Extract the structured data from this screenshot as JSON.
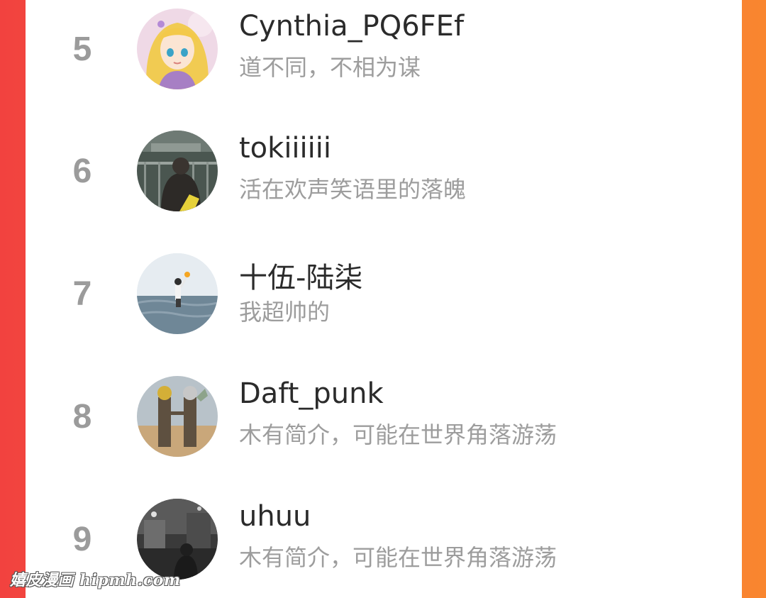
{
  "leaderboard": {
    "entries": [
      {
        "rank": "5",
        "username": "Cynthia_PQ6FEf",
        "bio": "道不同，不相为谋",
        "avatar_icon": "anime-girl-avatar"
      },
      {
        "rank": "6",
        "username": "tokiiiiii",
        "bio": "活在欢声笑语里的落魄",
        "avatar_icon": "bridge-railing-avatar"
      },
      {
        "rank": "7",
        "username": "十伍-陆柒",
        "bio": "我超帅的",
        "avatar_icon": "sea-torch-avatar"
      },
      {
        "rank": "8",
        "username": "Daft_punk",
        "bio": "木有简介，可能在世界角落游荡",
        "avatar_icon": "two-figures-avatar"
      },
      {
        "rank": "9",
        "username": "uhuu",
        "bio": "木有简介，可能在世界角落游荡",
        "avatar_icon": "night-street-avatar"
      }
    ]
  },
  "watermark": "嬉皮漫画 hipmh.com"
}
